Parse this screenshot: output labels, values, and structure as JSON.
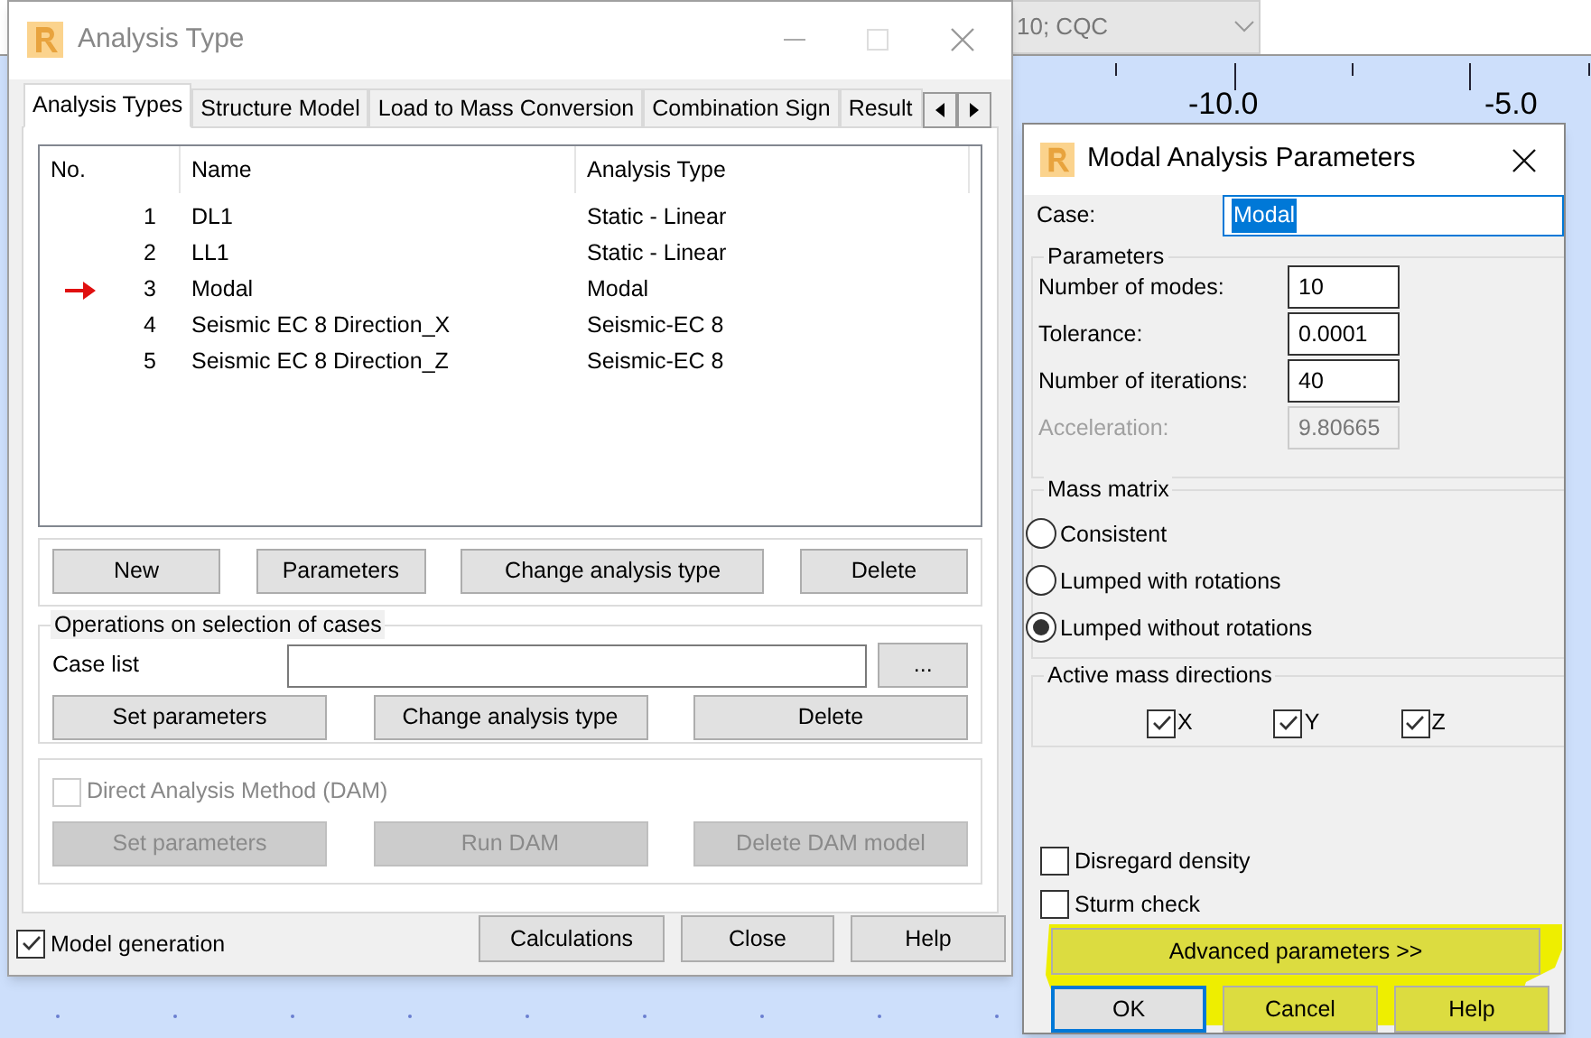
{
  "background": {
    "combo_value": "10; CQC",
    "ruler_labels": [
      "-10.0",
      "-5.0"
    ]
  },
  "analysis_dialog": {
    "title": "Analysis Type",
    "tabs": [
      {
        "label": "Analysis Types",
        "selected": true
      },
      {
        "label": "Structure Model",
        "selected": false
      },
      {
        "label": "Load to Mass Conversion",
        "selected": false
      },
      {
        "label": "Combination Sign",
        "selected": false
      },
      {
        "label": "Result",
        "selected": false
      }
    ],
    "table": {
      "columns": [
        "No.",
        "Name",
        "Analysis Type"
      ],
      "rows": [
        {
          "no": "1",
          "name": "DL1",
          "type": "Static - Linear",
          "current": false
        },
        {
          "no": "2",
          "name": "LL1",
          "type": "Static - Linear",
          "current": false
        },
        {
          "no": "3",
          "name": "Modal",
          "type": "Modal",
          "current": true
        },
        {
          "no": "4",
          "name": "Seismic EC 8 Direction_X",
          "type": "Seismic-EC 8",
          "current": false
        },
        {
          "no": "5",
          "name": "Seismic EC 8 Direction_Z",
          "type": "Seismic-EC 8",
          "current": false
        }
      ]
    },
    "case_buttons": [
      {
        "label": "New"
      },
      {
        "label": "Parameters"
      },
      {
        "label": "Change analysis type"
      },
      {
        "label": "Delete"
      }
    ],
    "selection_group": {
      "title": "Operations on selection of cases",
      "case_list_label": "Case list",
      "browse_button": "...",
      "buttons": [
        "Set parameters",
        "Change analysis type",
        "Delete"
      ]
    },
    "dam": {
      "label": "Direct Analysis Method (DAM)",
      "checked": false,
      "disabled": true,
      "buttons": [
        "Set parameters",
        "Run DAM",
        "Delete DAM model"
      ]
    },
    "model_generation": {
      "label": "Model generation",
      "checked": true
    },
    "footer_buttons": [
      {
        "label": "Calculations"
      },
      {
        "label": "Close"
      },
      {
        "label": "Help"
      }
    ]
  },
  "modal_dialog": {
    "title": "Modal Analysis Parameters",
    "case_label": "Case:",
    "case_value": "Modal",
    "parameters_title": "Parameters",
    "parameters": [
      {
        "label": "Number of modes:",
        "value": "10",
        "disabled": false
      },
      {
        "label": "Tolerance:",
        "value": "0.0001",
        "disabled": false
      },
      {
        "label": "Number of iterations:",
        "value": "40",
        "disabled": false
      },
      {
        "label": "Acceleration:",
        "value": "9.80665",
        "disabled": true
      }
    ],
    "mass_matrix_title": "Mass matrix",
    "mass_matrix": [
      {
        "label": "Consistent",
        "selected": false
      },
      {
        "label": "Lumped with rotations",
        "selected": false
      },
      {
        "label": "Lumped without rotations",
        "selected": true
      }
    ],
    "directions_title": "Active mass directions",
    "directions": [
      {
        "label": "X",
        "checked": true
      },
      {
        "label": "Y",
        "checked": true
      },
      {
        "label": "Z",
        "checked": true
      }
    ],
    "options": [
      {
        "label": "Disregard density",
        "checked": false
      },
      {
        "label": "Sturm check",
        "checked": false
      }
    ],
    "advanced_button": "Advanced parameters >>",
    "buttons": [
      {
        "label": "OK",
        "default": true
      },
      {
        "label": "Cancel",
        "default": false
      },
      {
        "label": "Help",
        "default": false
      }
    ],
    "highlighted": true
  }
}
